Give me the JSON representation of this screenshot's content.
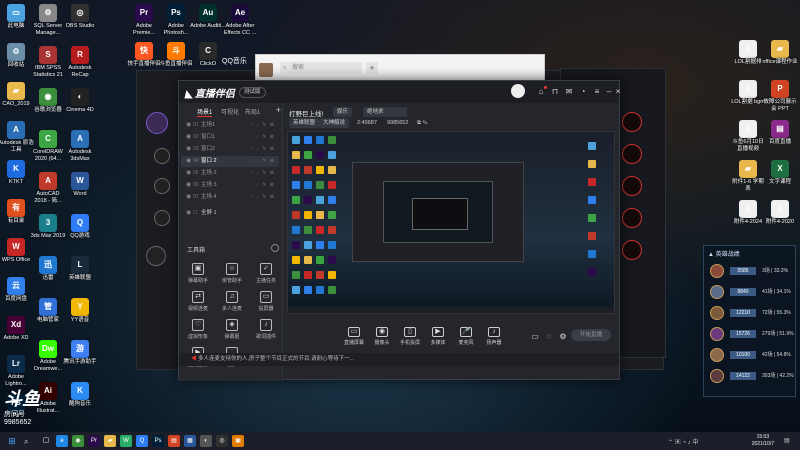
{
  "desktop": {
    "icons_left": [
      {
        "label": "此电脑",
        "icon": "computer-icon",
        "color": "#4aa3df",
        "glyph": "▭"
      },
      {
        "label": "回收站",
        "icon": "recycle-bin-icon",
        "color": "#6b8fa8",
        "glyph": "♲"
      },
      {
        "label": "CAO_2019",
        "icon": "folder-icon",
        "color": "#e8b84a",
        "glyph": "▰"
      },
      {
        "label": "Autodesk 原浩工具",
        "icon": "autodesk-icon",
        "color": "#2a6fb5",
        "glyph": "A"
      },
      {
        "label": "KTKT",
        "icon": "app-icon",
        "color": "#1e6be0",
        "glyph": "K"
      },
      {
        "label": "有目录",
        "icon": "app-icon",
        "color": "#e0501e",
        "glyph": "有"
      },
      {
        "label": "WPS Office",
        "icon": "wps-icon",
        "color": "#c62828",
        "glyph": "W"
      },
      {
        "label": "百度网盘",
        "icon": "baidu-netdisk-icon",
        "color": "#2f80ed",
        "glyph": "云"
      },
      {
        "label": "Adobe XD",
        "icon": "adobe-xd-icon",
        "color": "#470137",
        "glyph": "Xd"
      },
      {
        "label": "Adobe Lightro...",
        "icon": "lightroom-icon",
        "color": "#0a2b4a",
        "glyph": "Lr"
      },
      {
        "label": "Ps",
        "icon": "photoshop-icon",
        "color": "#001e36",
        "glyph": "Ps"
      }
    ],
    "icons_col2": [
      {
        "label": "SQL Server Manage...",
        "icon": "sql-server-icon",
        "color": "#888888",
        "glyph": "⚙"
      },
      {
        "label": "IBM SPSS Statistics 21",
        "icon": "spss-icon",
        "color": "#a33",
        "glyph": "S"
      },
      {
        "label": "谷歌浏览器",
        "icon": "chrome-icon",
        "color": "#3c8d3c",
        "glyph": "◉"
      },
      {
        "label": "CorelDRAW 2020 (64...",
        "icon": "coreldraw-icon",
        "color": "#3da544",
        "glyph": "C"
      },
      {
        "label": "AutoCAD 2018 - 简...",
        "icon": "autocad-icon",
        "color": "#c0392b",
        "glyph": "A"
      },
      {
        "label": "3ds Max 2019",
        "icon": "3dsmax-icon",
        "color": "#1a7f8a",
        "glyph": "3"
      },
      {
        "label": "迅雷",
        "icon": "xunlei-icon",
        "color": "#1f78d1",
        "glyph": "迅"
      },
      {
        "label": "电脑管家",
        "icon": "pc-manager-icon",
        "color": "#2f6fd6",
        "glyph": "管"
      },
      {
        "label": "Adobe Dreamwe...",
        "icon": "dreamweaver-icon",
        "color": "#35fa00",
        "glyph": "Dw"
      },
      {
        "label": "Adobe Illustrat...",
        "icon": "illustrator-icon",
        "color": "#330000",
        "glyph": "Ai"
      }
    ],
    "icons_col3": [
      {
        "label": "OBS Studio",
        "icon": "obs-icon",
        "color": "#303030",
        "glyph": "◎"
      },
      {
        "label": "Autodesk ReCap",
        "icon": "recap-icon",
        "color": "#b71c1c",
        "glyph": "R"
      },
      {
        "label": "Cinema 4D",
        "icon": "cinema4d-icon",
        "color": "#222",
        "glyph": "◐"
      },
      {
        "label": "Autodesk 3dsMax",
        "icon": "autodesk-icon",
        "color": "#2a6fb5",
        "glyph": "A"
      },
      {
        "label": "Word",
        "icon": "word-icon",
        "color": "#2b579a",
        "glyph": "W"
      },
      {
        "label": "QQ游戏",
        "icon": "qq-game-icon",
        "color": "#2e7df6",
        "glyph": "Q"
      },
      {
        "label": "英雄联盟",
        "icon": "lol-icon",
        "color": "#1a2a3a",
        "glyph": "L"
      },
      {
        "label": "YY语音",
        "icon": "yy-icon",
        "color": "#f2b705",
        "glyph": "Y"
      },
      {
        "label": "腾讯手游助手",
        "icon": "tencent-assistant-icon",
        "color": "#3d7ff2",
        "glyph": "游"
      },
      {
        "label": "酷狗音乐",
        "icon": "kugou-icon",
        "color": "#2a8bf2",
        "glyph": "K"
      }
    ],
    "icons_top": [
      {
        "label": "Adobe Premie...",
        "icon": "premiere-icon",
        "color": "#2a0a4a",
        "glyph": "Pr"
      },
      {
        "label": "Adobe Photosh...",
        "icon": "photoshop-icon",
        "color": "#001e36",
        "glyph": "Ps"
      },
      {
        "label": "Adobe Auditi...",
        "icon": "audition-icon",
        "color": "#00302b",
        "glyph": "Au"
      },
      {
        "label": "Adobe After Effects CC ...",
        "icon": "after-effects-icon",
        "color": "#1a0a3a",
        "glyph": "Ae"
      }
    ],
    "icons_top2": [
      {
        "label": "快手直播伴侣",
        "icon": "kuaishou-icon",
        "color": "#ff5722",
        "glyph": "快"
      },
      {
        "label": "斗鱼直播伴侣",
        "icon": "douyu-icon",
        "color": "#ff7b00",
        "glyph": "斗"
      },
      {
        "label": "ClickO",
        "icon": "app-icon",
        "color": "#2a2a2a",
        "glyph": "C"
      }
    ],
    "icons_right": [
      {
        "label": "LOL割据排",
        "icon": "document-icon",
        "color": "#f0f0f0",
        "glyph": "▯"
      },
      {
        "label": "office课程作业",
        "icon": "folder-icon",
        "color": "#e8b84a",
        "glyph": "▰"
      },
      {
        "label": "LOL割据 bgm",
        "icon": "document-icon",
        "color": "#f0f0f0",
        "glyph": "▯"
      },
      {
        "label": "故障公司展示会 PPT",
        "icon": "ppt-icon",
        "color": "#d04423",
        "glyph": "P"
      },
      {
        "label": "斗鱼6月10日直播视频",
        "icon": "document-icon",
        "color": "#f0f0f0",
        "glyph": "▯"
      },
      {
        "label": "百度直播",
        "icon": "winrar-icon",
        "color": "#8a2a8a",
        "glyph": "▤"
      },
      {
        "label": "附件1-6 学期表",
        "icon": "folder-icon",
        "color": "#e8b84a",
        "glyph": "▰"
      },
      {
        "label": "文字课程",
        "icon": "excel-icon",
        "color": "#1d6f42",
        "glyph": "X"
      },
      {
        "label": "附件4-2024",
        "icon": "document-icon",
        "color": "#f0f0f0",
        "glyph": "▯"
      },
      {
        "label": "附件4-2020",
        "icon": "document-icon",
        "color": "#f0f0f0",
        "glyph": "▯"
      }
    ],
    "qq_label": "QQ音乐"
  },
  "wechat": {
    "search_placeholder": "搜索",
    "add_glyph": "+"
  },
  "app": {
    "title": "直播伴侣",
    "version": "测试版",
    "left_tabs": [
      "场景1",
      "可视化",
      "布局1"
    ],
    "scenes": [
      {
        "num": "01",
        "name": "主场1",
        "active": false
      },
      {
        "num": "02",
        "name": "窗口1",
        "active": false
      },
      {
        "num": "03",
        "name": "窗口2",
        "active": false
      },
      {
        "num": "04",
        "name": "窗口 2",
        "active": true
      },
      {
        "num": "05",
        "name": "主场 2",
        "active": false
      },
      {
        "num": "06",
        "name": "主场 3",
        "active": false
      },
      {
        "num": "07",
        "name": "主场 4",
        "active": false
      }
    ],
    "scene_selected": "全屏 1",
    "tools_header": "工具箱",
    "tools": [
      {
        "label": "弹幕助手",
        "glyph": "▣"
      },
      {
        "label": "房管助手",
        "glyph": "☺"
      },
      {
        "label": "主播任务",
        "glyph": "✓"
      },
      {
        "label": "视频连麦",
        "glyph": "⇄"
      },
      {
        "label": "多人连麦",
        "glyph": "♫"
      },
      {
        "label": "投屏器",
        "glyph": "▭"
      },
      {
        "label": "虚拟形象",
        "glyph": "♡"
      },
      {
        "label": "弹幕姬",
        "glyph": "◈"
      },
      {
        "label": "歌词插件",
        "glyph": "♪"
      },
      {
        "label": "直播回看",
        "glyph": "▶"
      },
      {
        "label": "更多",
        "glyph": "…"
      }
    ],
    "stream_title": "打野巨上线!",
    "pills_row1": [
      "娱乐",
      "绝地求"
    ],
    "pills_row2": [
      "英雄联盟",
      "大神解说"
    ],
    "views": "2:49687",
    "likes": "9985652",
    "bottom_tools": [
      {
        "label": "直播屏幕",
        "glyph": "▭"
      },
      {
        "label": "摄像头",
        "glyph": "◉"
      },
      {
        "label": "手机投屏",
        "glyph": "▯"
      },
      {
        "label": "多媒体",
        "glyph": "▶"
      },
      {
        "label": "麦克风",
        "glyph": "🎤"
      },
      {
        "label": "扬声器",
        "glyph": "♪"
      }
    ],
    "start_button": "开始直播",
    "notice": "多人连麦支持你的人,房子整个节目正式的节目,请耐心等待下一..."
  },
  "game_panel": {
    "title": "英雄战绩",
    "rows": [
      {
        "score": "5585",
        "rate": "3场 | 33.3%"
      },
      {
        "score": "8840",
        "rate": "41场 | 34.1%"
      },
      {
        "score": "12210",
        "rate": "72场 | 55.3%"
      },
      {
        "score": "15726",
        "rate": "279场 | 51.9%"
      },
      {
        "score": "10100",
        "rate": "42场 | 54.8%"
      },
      {
        "score": "14122",
        "rate": "303场 | 42.2%"
      }
    ]
  },
  "streamer": {
    "name_big": "斗鱼",
    "tag": "房间号",
    "room_id": "9985652"
  },
  "taskbar": {
    "time": "15:03",
    "date": "2021/10/7",
    "apps": [
      {
        "icon": "edge-icon",
        "color": "#1f88e5",
        "glyph": "e"
      },
      {
        "icon": "chrome-icon",
        "color": "#3c8d3c",
        "glyph": "◉"
      },
      {
        "icon": "premiere-icon",
        "color": "#2a0a4a",
        "glyph": "Pr"
      },
      {
        "icon": "file-explorer-icon",
        "color": "#e8b84a",
        "glyph": "▰"
      },
      {
        "icon": "wechat-icon",
        "color": "#2aae67",
        "glyph": "W"
      },
      {
        "icon": "qq-icon",
        "color": "#2e7df6",
        "glyph": "Q"
      },
      {
        "icon": "photoshop-icon",
        "color": "#001e36",
        "glyph": "Ps"
      },
      {
        "icon": "app-icon",
        "color": "#d04423",
        "glyph": "▤"
      },
      {
        "icon": "app-icon",
        "color": "#2b579a",
        "glyph": "▦"
      },
      {
        "icon": "app-icon",
        "color": "#555",
        "glyph": "◐"
      },
      {
        "icon": "obs-icon",
        "color": "#303030",
        "glyph": "◎"
      },
      {
        "icon": "live-companion-icon",
        "color": "#e07b00",
        "glyph": "▣"
      }
    ]
  }
}
